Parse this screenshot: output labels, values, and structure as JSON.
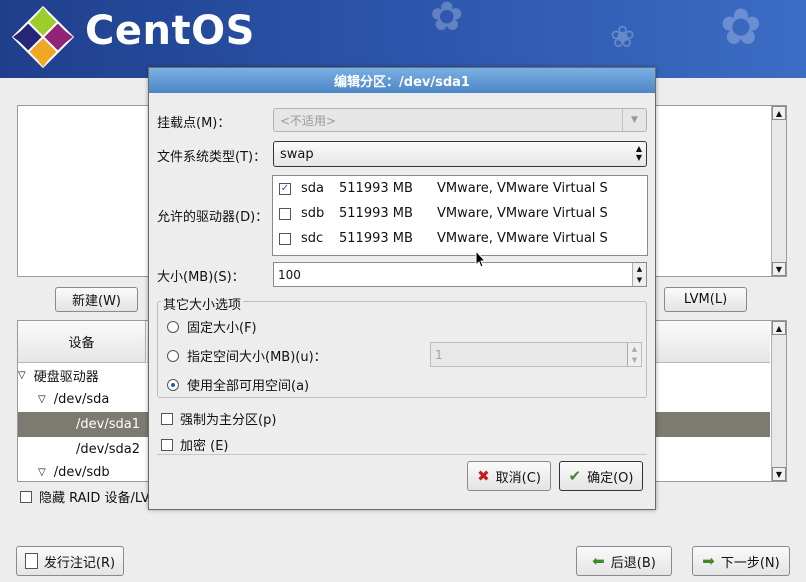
{
  "brand": {
    "name": "CentOS"
  },
  "background": {
    "new_button": "新建(W)",
    "lvm_button": "LVM(L)",
    "device_column": "设备",
    "tree": [
      {
        "label": "硬盘驱动器",
        "level": 0,
        "expanded": true
      },
      {
        "label": "/dev/sda",
        "level": 1,
        "expanded": true
      },
      {
        "label": "/dev/sda1",
        "level": 2,
        "selected": true
      },
      {
        "label": "/dev/sda2",
        "level": 2
      },
      {
        "label": "/dev/sdb",
        "level": 1,
        "expanded": true
      }
    ],
    "hide_raid": "隐藏 RAID 设备/LV",
    "release_notes_button": "发行注记(R)",
    "back_button": "后退(B)",
    "next_button": "下一步(N)"
  },
  "dialog": {
    "title": "编辑分区：/dev/sda1",
    "mount_point_label": "挂载点(M)：",
    "mount_point_value": "<不适用>",
    "fs_type_label": "文件系统类型(T)：",
    "fs_type_value": "swap",
    "drives_label": "允许的驱动器(D)：",
    "drives": [
      {
        "name": "sda",
        "size": "511993 MB",
        "model": "VMware, VMware Virtual S",
        "checked": true
      },
      {
        "name": "sdb",
        "size": "511993 MB",
        "model": "VMware, VMware Virtual S",
        "checked": false
      },
      {
        "name": "sdc",
        "size": "511993 MB",
        "model": "VMware, VMware Virtual S",
        "checked": false
      }
    ],
    "size_label": "大小(MB)(S)：",
    "size_value": "100",
    "other_size_title": "其它大小选项",
    "opt_fixed": "固定大小(F)",
    "opt_fill_to": "指定空间大小(MB)(u)：",
    "fill_to_value": "1",
    "opt_fill_max": "使用全部可用空间(a)",
    "selected_option": "fill_max",
    "force_primary": "强制为主分区(p)",
    "encrypt": "加密 (E)",
    "cancel_button": "取消(C)",
    "ok_button": "确定(O)"
  },
  "colors": {
    "header": "#2a53a8",
    "title_bar": "#5b93cf",
    "selection": "#7d7a72"
  }
}
